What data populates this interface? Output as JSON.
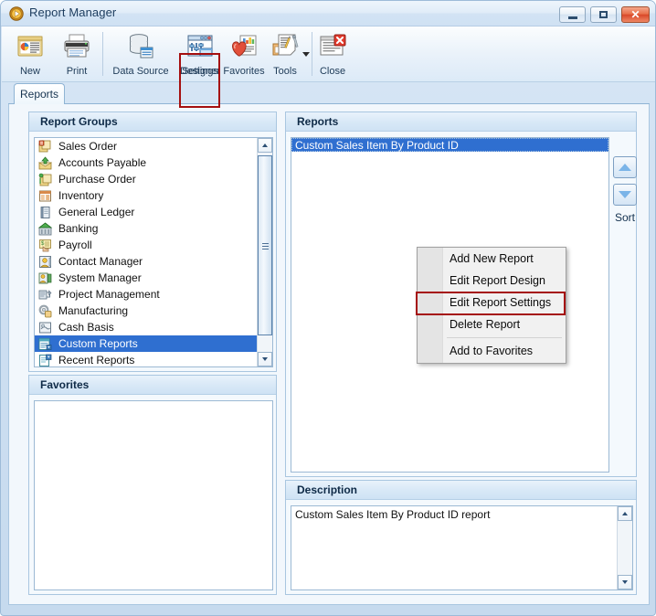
{
  "window": {
    "title": "Report Manager",
    "title_icon": "play-circle-icon",
    "controls": {
      "minimize": "minimize-button",
      "maximize": "maximize-button",
      "close": "close-button",
      "close_glyph": "✕"
    }
  },
  "toolbar": {
    "buttons": [
      {
        "label": "New",
        "icon": "new-report-icon"
      },
      {
        "label": "Print",
        "icon": "printer-icon"
      },
      {
        "label": "Data Source",
        "icon": "database-icon"
      },
      {
        "label": "Designer",
        "icon": "designer-pencil-icon"
      },
      {
        "label": "Settings",
        "icon": "settings-window-icon"
      },
      {
        "label": "Favorites",
        "icon": "favorites-heart-icon"
      },
      {
        "label": "Tools",
        "icon": "tools-wrench-icon"
      },
      {
        "label": "Close",
        "icon": "close-window-icon"
      }
    ],
    "highlighted_button": "Settings",
    "highlight_color": "#a50f0f"
  },
  "tabs": [
    {
      "label": "Reports",
      "active": true
    }
  ],
  "report_groups": {
    "header": "Report Groups",
    "items": [
      {
        "label": "Sales Order",
        "icon": "sales-order-icon",
        "selected": false
      },
      {
        "label": "Accounts Payable",
        "icon": "accounts-payable-icon",
        "selected": false
      },
      {
        "label": "Purchase Order",
        "icon": "purchase-order-icon",
        "selected": false
      },
      {
        "label": "Inventory",
        "icon": "inventory-icon",
        "selected": false
      },
      {
        "label": "General Ledger",
        "icon": "general-ledger-icon",
        "selected": false
      },
      {
        "label": "Banking",
        "icon": "banking-icon",
        "selected": false
      },
      {
        "label": "Payroll",
        "icon": "payroll-icon",
        "selected": false
      },
      {
        "label": "Contact Manager",
        "icon": "contact-manager-icon",
        "selected": false
      },
      {
        "label": "System Manager",
        "icon": "system-manager-icon",
        "selected": false
      },
      {
        "label": "Project Management",
        "icon": "project-management-icon",
        "selected": false
      },
      {
        "label": "Manufacturing",
        "icon": "manufacturing-icon",
        "selected": false
      },
      {
        "label": "Cash Basis",
        "icon": "cash-basis-icon",
        "selected": false
      },
      {
        "label": "Custom Reports",
        "icon": "custom-reports-icon",
        "selected": true
      },
      {
        "label": "Recent Reports",
        "icon": "recent-reports-icon",
        "selected": false
      }
    ],
    "selected_label": "Custom Reports",
    "selection_color": "#2f6fd0"
  },
  "favorites": {
    "header": "Favorites",
    "items": []
  },
  "reports": {
    "header": "Reports",
    "items": [
      {
        "label": "Custom Sales Item By Product ID",
        "selected": true
      }
    ],
    "sort_label": "Sort",
    "sort_up_icon": "sort-up-icon",
    "sort_down_icon": "sort-down-icon"
  },
  "description": {
    "header": "Description",
    "text": "Custom Sales Item By Product ID report"
  },
  "context_menu": {
    "items": [
      {
        "label": "Add New Report",
        "highlighted": false,
        "separator_after": false
      },
      {
        "label": "Edit Report Design",
        "highlighted": false,
        "separator_after": false
      },
      {
        "label": "Edit Report Settings",
        "highlighted": true,
        "separator_after": false
      },
      {
        "label": "Delete Report",
        "highlighted": false,
        "separator_after": true
      },
      {
        "label": "Add to Favorites",
        "highlighted": false,
        "separator_after": false
      }
    ],
    "highlight_color": "#a50f0f"
  }
}
